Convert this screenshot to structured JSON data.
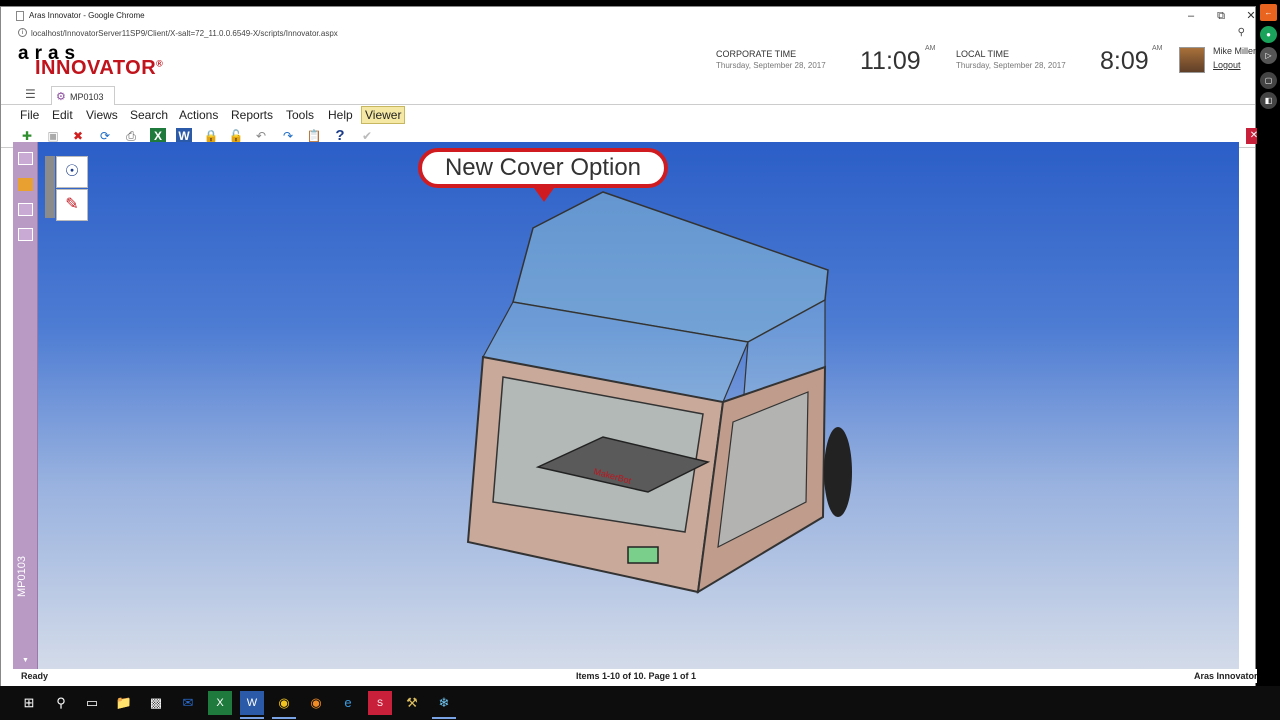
{
  "window": {
    "title": "Aras Innovator - Google Chrome",
    "url": "localhost/InnovatorServer11SP9/Client/X-salt=72_11.0.0.6549-X/scripts/Innovator.aspx"
  },
  "header": {
    "logo_top": "aras",
    "logo_bottom": "INNOVATOR",
    "logo_reg": "®",
    "corporate_label": "CORPORATE TIME",
    "corporate_date": "Thursday, September 28, 2017",
    "corporate_time": "11:09",
    "corporate_ampm": "AM",
    "local_label": "LOCAL TIME",
    "local_date": "Thursday, September 28, 2017",
    "local_time": "8:09",
    "local_ampm": "AM",
    "user_name": "Mike Miller",
    "logout": "Logout"
  },
  "tabs": [
    {
      "label": "MP0103",
      "icon": "gear-icon"
    }
  ],
  "menu": [
    "File",
    "Edit",
    "Views",
    "Search",
    "Actions",
    "Reports",
    "Tools",
    "Help",
    "Viewer"
  ],
  "toolbar": {
    "icons": [
      "new-icon",
      "save-icon",
      "delete-icon",
      "refresh-icon",
      "print-icon",
      "excel-icon",
      "word-icon",
      "lock-icon",
      "unlock-icon",
      "undo-icon",
      "promote-icon",
      "clipboard-icon",
      "help-icon",
      "check-icon"
    ]
  },
  "viewer": {
    "side_label": "MP0103",
    "callout": "New Cover Option",
    "printer_badge": "MakerBot"
  },
  "status": {
    "left": "Ready",
    "center": "Items 1-10 of 10. Page 1 of 1",
    "right": "Aras Innovator"
  },
  "colors": {
    "brand_red": "#c0131c",
    "callout_border": "#d01c20",
    "side_panel": "#b89ac4",
    "viewer_top": "#2b5ec7",
    "viewer_bottom": "#d3dbe9",
    "active_menu": "#f5e8a4"
  }
}
